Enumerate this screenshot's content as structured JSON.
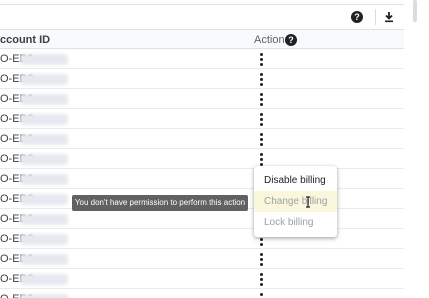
{
  "toolbar": {
    "help_icon": "help-circle-icon",
    "download_icon": "download-icon"
  },
  "table": {
    "header": {
      "account": "ccount ID",
      "actions": "Actions",
      "help_glyph": "?"
    },
    "row_prefix": "O-ED9",
    "rows": [
      {
        "id": "O-ED9"
      },
      {
        "id": "O-ED9"
      },
      {
        "id": "O-ED9"
      },
      {
        "id": "O-ED9"
      },
      {
        "id": "O-ED9"
      },
      {
        "id": "O-ED9"
      },
      {
        "id": "O-ED9"
      },
      {
        "id": "O-ED9"
      },
      {
        "id": "O-ED9"
      },
      {
        "id": "O-ED9"
      },
      {
        "id": "O-ED9"
      },
      {
        "id": "O-ED9"
      },
      {
        "id": "O-ED9"
      }
    ]
  },
  "tooltip": {
    "text": "You don't have permission to perform this action"
  },
  "menu": {
    "items": [
      {
        "label": "Disable billing",
        "state": "enabled"
      },
      {
        "label": "Change billing",
        "state": "disabled-hovered"
      },
      {
        "label": "Lock billing",
        "state": "disabled"
      }
    ]
  },
  "colors": {
    "menu_hover": "#fbf7dd",
    "tooltip_bg": "#616161",
    "disabled_text": "#9aa0a6"
  }
}
